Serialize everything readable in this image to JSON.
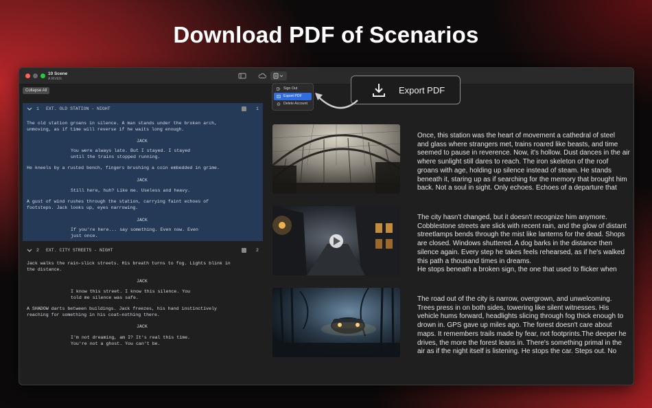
{
  "headline": "Download PDF of Scenarios",
  "window": {
    "title": "10 Scene",
    "subtitle": "A RIVER."
  },
  "toolbar": {
    "collapse_all": "Collapse All"
  },
  "menu": {
    "items": [
      {
        "label": "Sign Out"
      },
      {
        "label": "Export PDF"
      },
      {
        "label": "Delete Account"
      }
    ],
    "active_index": 1
  },
  "callout": {
    "label": "Export PDF",
    "icon": "download-icon"
  },
  "scenes": [
    {
      "number": "1",
      "heading": "EXT. OLD STATION - NIGHT",
      "blocks": [
        "The old station groans in silence. A man stands under the broken arch,\nunmoving, as if time will reverse if he waits long enough.",
        "JACK",
        "You were always late. But I stayed. I stayed\nuntil the trains stopped running.",
        "He kneels by a rusted bench, fingers brushing a coin embedded in grime.",
        "JACK",
        "Still here, huh? Like me. Useless and heavy.",
        "A gust of wind rushes through the station, carrying faint echoes of\nfootsteps. Jack looks up, eyes narrowing.",
        "JACK",
        "If you're here... say something. Even now. Even\njust once."
      ]
    },
    {
      "number": "2",
      "heading": "EXT. CITY STREETS - NIGHT",
      "blocks": [
        "Jack walks the rain-slick streets. His breath turns to fog. Lights blink in\nthe distance.",
        "JACK",
        "I know this street. I know this silence. You\ntold me silence was safe.",
        "A SHADOW darts between buildings. Jack freezes, his hand instinctively\nreaching for something in his coat—nothing there.",
        "JACK",
        "I'm not dreaming, am I? It's real this time.\nYou're not a ghost. You can't be."
      ]
    }
  ],
  "cards": [
    {
      "image": "train-station-image",
      "text": "Once, this station was the heart of movement a cathedral of steel\nand glass where strangers met, trains roared like beasts, and time\nseemed to pause in reverence. Now, it's hollow. Dust dances in the air\nwhere sunlight still dares to reach. The iron skeleton of the roof\ngroans with age, holding up silence instead of steam. He stands\nbeneath it, staring up as if searching for the memory that brought him\nback. Not a soul in sight. Only echoes. Echoes of a departure that"
    },
    {
      "image": "city-street-video",
      "text": "The city hasn't changed, but it doesn't recognize him anymore.\nCobblestone streets are slick with recent rain, and the glow of distant\nstreetlamps bends through the mist like lanterns for the dead. Shops\nare closed. Windows shuttered. A dog barks in the distance then\nsilence again. Every step he takes feels rehearsed, as if he's walked\nthis path a thousand times in dreams.\nHe stops beneath a broken sign, the one that used to flicker when"
    },
    {
      "image": "forest-car-image",
      "text": "The road out of the city is narrow, overgrown, and unwelcoming.\nTrees press in on both sides, towering like silent witnesses. His\nvehicle hums forward, headlights slicing through fog thick enough to\ndrown in. GPS gave up miles ago. The forest doesn't care about\nmaps. It remembers trails made by fear, not footprints.The deeper he\ndrives, the more the forest leans in. There's something primal in the\nair as if the night itself is listening. He stops the car. Steps out. No"
    }
  ]
}
